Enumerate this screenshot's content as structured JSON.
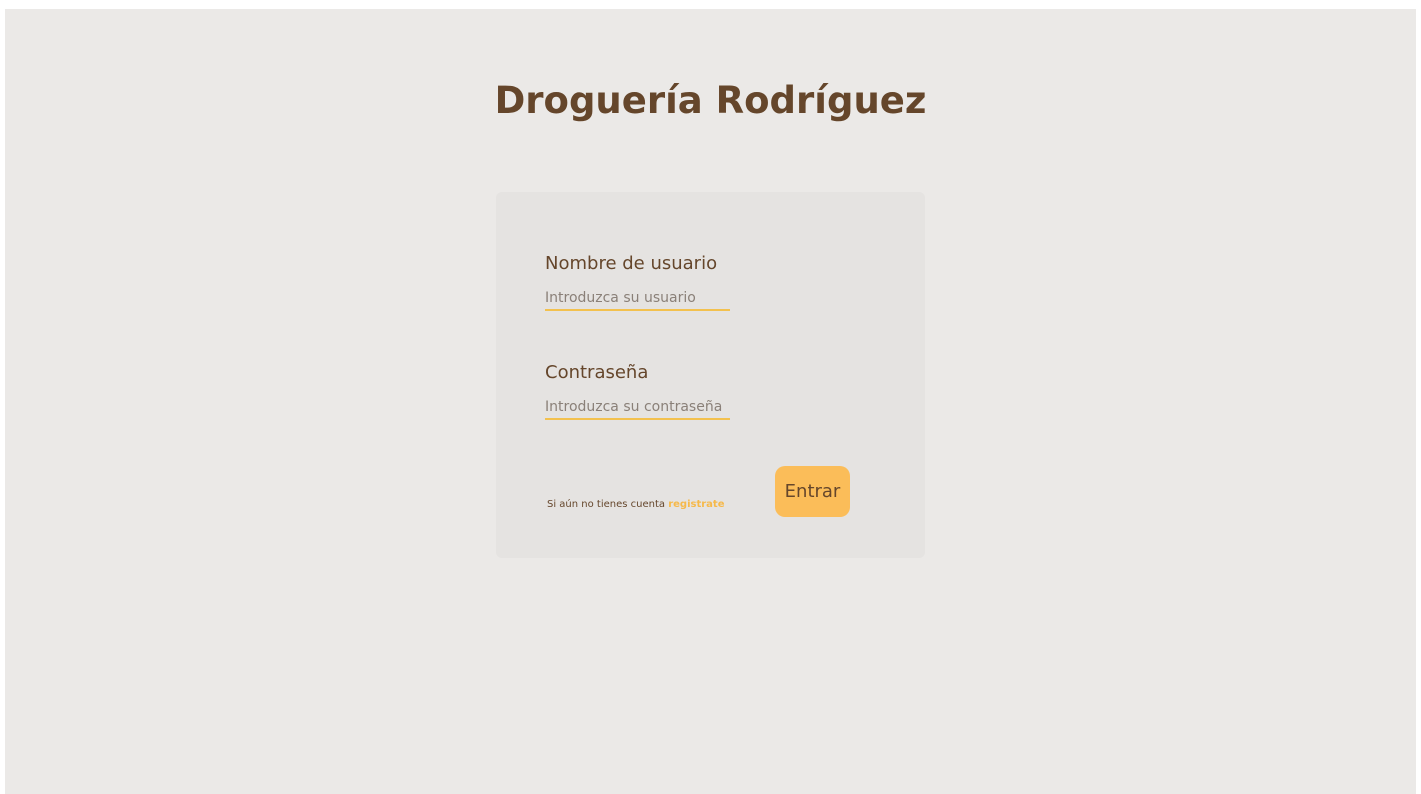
{
  "app": {
    "title": "Droguería Rodríguez"
  },
  "login": {
    "username_label": "Nombre de usuario",
    "username_placeholder": "Introduzca su usuario",
    "username_value": "",
    "password_label": "Contraseña",
    "password_placeholder": "Introduzca su contraseña",
    "password_value": "",
    "register_text": "Si aún no tienes cuenta",
    "register_link": "registrate",
    "submit_label": "Entrar"
  },
  "colors": {
    "background": "#ebe9e7",
    "card": "#e5e3e1",
    "text_brown": "#65462b",
    "accent": "#fbbd59",
    "underline": "#f3c14e"
  }
}
